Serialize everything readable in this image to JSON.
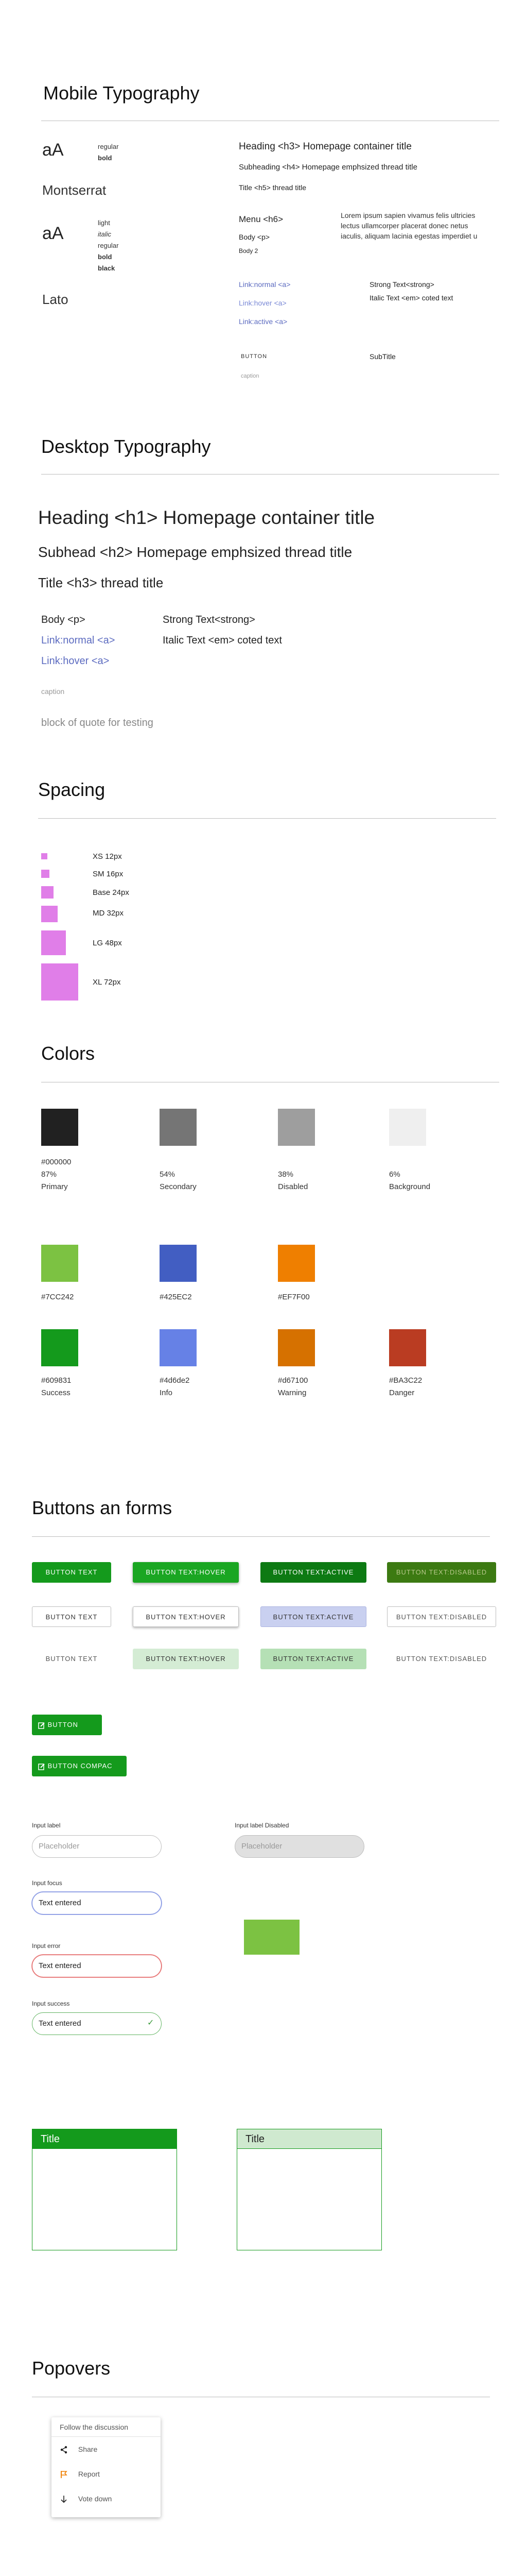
{
  "mobile": {
    "title": "Mobile Typography",
    "aa1": "aA",
    "montserrat": "Montserrat",
    "weights1": [
      "regular",
      "bold"
    ],
    "aa2": "aA",
    "lato": "Lato",
    "weights2": [
      "light",
      "italic",
      "regular",
      "bold",
      "black"
    ],
    "h3": "Heading <h3> Homepage container title",
    "h4": "Subheading <h4> Homepage emphsized  thread title",
    "h5": "Title <h5> thread title",
    "menu": "Menu <h6>",
    "body": "Body <p>",
    "body2": "Body 2",
    "lorem": "Lorem ipsum sapien vivamus felis ultricies lectus ullamcorper placerat donec netus iaculis, aliquam lacinia egestas imperdiet u",
    "link_normal": "Link:normal <a>",
    "link_hover": "Link:hover <a>",
    "link_active": "Link:active <a>",
    "strong": "Strong  Text<strong>",
    "italic": "Italic Text <em> coted text",
    "button": "BUTTON",
    "subtitle": "SubTitle",
    "caption": "caption"
  },
  "desktop": {
    "title": "Desktop Typography",
    "h1": "Heading <h1> Homepage container title",
    "h2": "Subhead <h2> Homepage emphsized  thread title",
    "h3": "Title <h3> thread title",
    "body": "Body <p>",
    "strong": "Strong  Text<strong>",
    "link_normal": "Link:normal <a>",
    "italic": "Italic Text <em> coted text",
    "link_hover": "Link:hover <a>",
    "caption": "caption",
    "quote": "block of quote for testing"
  },
  "spacing": {
    "title": "Spacing",
    "items": [
      "XS 12px",
      "SM 16px",
      "Base 24px",
      "MD 32px",
      "LG 48px",
      "XL 72px"
    ],
    "color": "#e07ee8"
  },
  "colors": {
    "title": "Colors",
    "row1": [
      {
        "hex": "#000000",
        "pct": "87%",
        "name": "Primary",
        "color": "#212121"
      },
      {
        "hex": "",
        "pct": "54%",
        "name": "Secondary",
        "color": "#757575"
      },
      {
        "hex": "",
        "pct": "38%",
        "name": "Disabled",
        "color": "#9e9e9e"
      },
      {
        "hex": "",
        "pct": "6%",
        "name": "Background",
        "color": "#efefef"
      }
    ],
    "row2": [
      {
        "hex": "#7CC242",
        "color": "#7cc242"
      },
      {
        "hex": "#425EC2",
        "color": "#425ec2"
      },
      {
        "hex": "#EF7F00",
        "color": "#ef7f00"
      }
    ],
    "row3": [
      {
        "hex": "#609831",
        "name": "Success",
        "color": "#149a1c"
      },
      {
        "hex": "#4d6de2",
        "name": "Info",
        "color": "#6681e6"
      },
      {
        "hex": "#d67100",
        "name": "Warning",
        "color": "#d67100"
      },
      {
        "hex": "#BA3C22",
        "name": "Danger",
        "color": "#ba3c22"
      }
    ]
  },
  "buttons": {
    "title": "Buttons an forms",
    "filled": [
      "BUTTON TEXT",
      "BUTTON TEXT:HOVER",
      "BUTTON TEXT:ACTIVE",
      "BUTTON TEXT:DISABLED"
    ],
    "outline": [
      "BUTTON TEXT",
      "BUTTON TEXT:HOVER",
      "BUTTON TEXT:ACTIVE",
      "BUTTON TEXT:DISABLED"
    ],
    "text": [
      "BUTTON TEXT",
      "BUTTON TEXT:HOVER",
      "BUTTON TEXT:ACTIVE",
      "BUTTON TEXT:DISABLED"
    ],
    "icon_button": "BUTTON",
    "icon_button_compact": "BUTTON COMPAC",
    "accent": "#149a1c"
  },
  "forms": {
    "label": "Input label",
    "placeholder": "Placeholder",
    "label_disabled": "Input label Disabled",
    "placeholder_disabled": "Placeholder",
    "label_focus": "Input focus",
    "value_focus": "Text entered",
    "label_error": "Input error",
    "value_error": "Text entered",
    "label_success": "Input success",
    "value_success": "Text entered"
  },
  "cards": {
    "card1_title": "Title",
    "card2_title": "Title"
  },
  "popovers": {
    "title": "Popovers",
    "header": "Follow the discussion",
    "items": [
      {
        "label": "Share",
        "icon": "share-icon"
      },
      {
        "label": "Report",
        "icon": "flag-icon"
      },
      {
        "label": "Vote down",
        "icon": "arrow-down-icon"
      }
    ]
  }
}
